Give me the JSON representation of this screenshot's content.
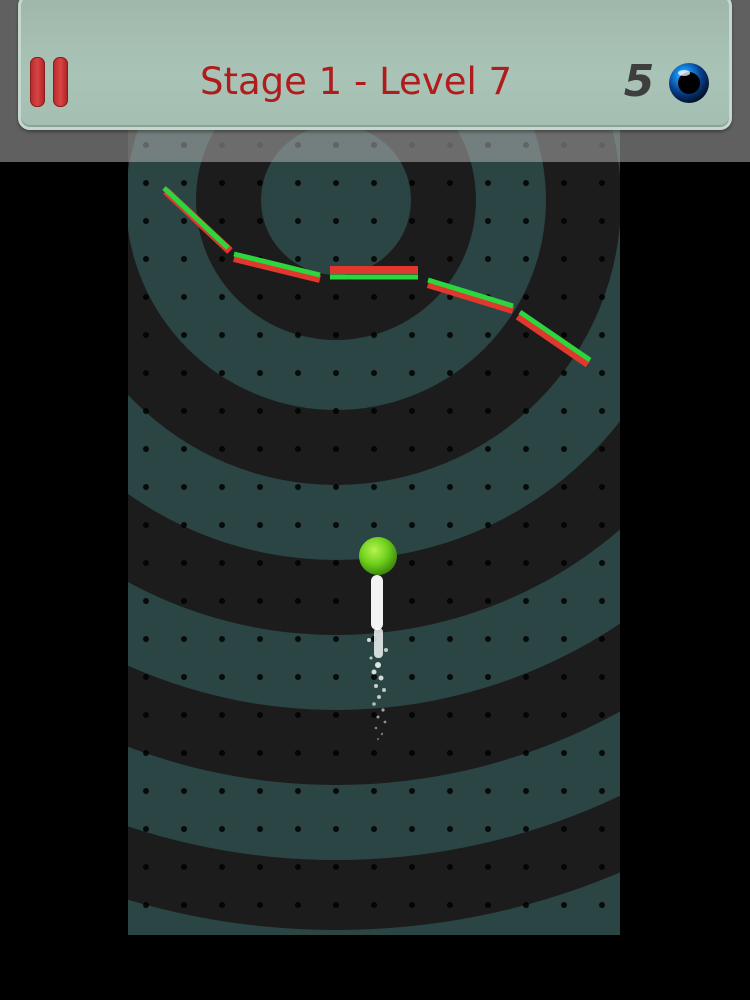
{
  "hud": {
    "level_title": "Stage 1 - Level 7",
    "lives": "5",
    "pause_icon": "pause-icon",
    "lives_icon": "blue-ball-icon"
  },
  "colors": {
    "title": "#b01c1c",
    "platform_top": "#2cd63c",
    "platform_bottom": "#e0372f",
    "ball": "#6fd11c",
    "ring_dark": "#1a1a1a",
    "ring_teal": "#2c4646"
  },
  "game": {
    "platforms": "zigzag-platform-chain",
    "ball": "green-ball",
    "trail": "white-particle-trail"
  }
}
